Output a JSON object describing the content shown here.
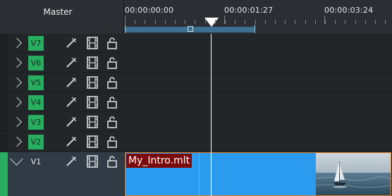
{
  "header": {
    "master_label": "Master"
  },
  "ruler": {
    "timecodes": [
      "00:00:00:00",
      "00:00:01:27",
      "00:00:03:24"
    ]
  },
  "tracks": [
    {
      "label": "V7"
    },
    {
      "label": "V6"
    },
    {
      "label": "V5"
    },
    {
      "label": "V4"
    },
    {
      "label": "V3"
    },
    {
      "label": "V2"
    },
    {
      "label": "V1"
    }
  ],
  "clip": {
    "name": "My_Intro.mlt"
  },
  "colors": {
    "track_tag": "#27ae60",
    "clip_fill": "#2b9bf0",
    "clip_border": "#e67e22",
    "clip_name_bg": "#7b0a0a",
    "zone_bar": "#3f6f90"
  },
  "icons": [
    "expand-arrow-icon",
    "effect-wand-icon",
    "film-strip-icon",
    "lock-open-icon"
  ]
}
